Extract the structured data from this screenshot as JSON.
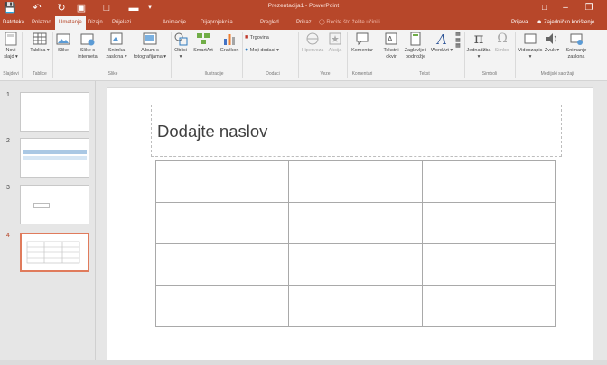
{
  "window": {
    "title": "Prezentacija1 - PowerPoint",
    "signin": "Prijava",
    "share": "Zajedničko korištenje"
  },
  "menu": {
    "tabs": [
      "Datoteka",
      "Polazno",
      "Umetanje",
      "Dizajn",
      "Prijelazi",
      "Animacije",
      "Dijaprojekcija",
      "Pregled",
      "Prikaz"
    ],
    "active_tab": "Umetanje",
    "tell_me": "Recite što želite učiniti..."
  },
  "ribbon": {
    "buttons": {
      "novi_slajd": "Novi slajd ▾",
      "tablica": "Tablica ▾",
      "slike": "Slike",
      "slike_interneta": "Slike s interneta",
      "snimka_zaslona": "Snimka zaslona ▾",
      "album": "Album s fotografijama ▾",
      "oblici": "Oblici ▾",
      "smartart": "SmartArt",
      "grafikon": "Grafikon",
      "trgovina": "Trgovina",
      "moji_dodaci": "Moji dodaci ▾",
      "hiperveza": "Hiperveza",
      "akcija": "Akcija",
      "komentar": "Komentar",
      "tekstni_okvir": "Tekstni okvir",
      "zaglavlje": "Zaglavlje i podnožje",
      "wordart": "WordArt ▾",
      "jednadzba": "Jednadžba ▾",
      "simbol": "Simbol",
      "videozapis": "Videozapis ▾",
      "zvuk": "Zvuk ▾",
      "snimanje": "Snimanje zaslona"
    },
    "groups": {
      "slajdovi": "Slajdovi",
      "tablice": "Tablice",
      "slike": "Slike",
      "ilustracije": "Ilustracije",
      "dodaci": "Dodaci",
      "veze": "Veze",
      "komentari": "Komentari",
      "tekst": "Tekst",
      "simboli": "Simboli",
      "mediji": "Medijski sadržaji"
    }
  },
  "slides": [
    {
      "number": "1"
    },
    {
      "number": "2"
    },
    {
      "number": "3"
    },
    {
      "number": "4"
    }
  ],
  "slide": {
    "title_placeholder": "Dodajte naslov",
    "table": {
      "rows": 4,
      "cols": 3
    }
  },
  "colors": {
    "accent": "#b7472a",
    "selected_thumb": "#e07b5c"
  }
}
